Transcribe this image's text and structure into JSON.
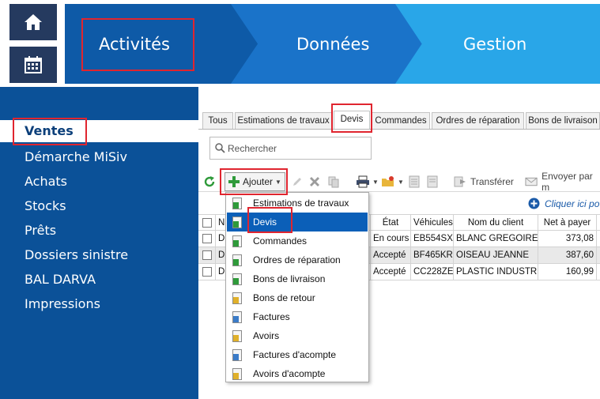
{
  "banner": {
    "steps": [
      {
        "label": "Activités"
      },
      {
        "label": "Données"
      },
      {
        "label": "Gestion"
      }
    ]
  },
  "sidebar": {
    "items": [
      {
        "label": "Ventes"
      },
      {
        "label": "Démarche MiSiv"
      },
      {
        "label": "Achats"
      },
      {
        "label": "Stocks"
      },
      {
        "label": "Prêts"
      },
      {
        "label": "Dossiers sinistre"
      },
      {
        "label": "BAL DARVA"
      },
      {
        "label": "Impressions"
      }
    ],
    "active": "Ventes"
  },
  "tabs": {
    "items": [
      {
        "label": "Tous"
      },
      {
        "label": "Estimations de travaux"
      },
      {
        "label": "Devis"
      },
      {
        "label": "Commandes"
      },
      {
        "label": "Ordres de réparation"
      },
      {
        "label": "Bons de livraison"
      }
    ],
    "active": "Devis"
  },
  "search": {
    "placeholder": "Rechercher"
  },
  "toolbar": {
    "add_label": "Ajouter",
    "transfer_label": "Transférer",
    "send_label": "Envoyer par m"
  },
  "link": {
    "label": "Cliquer ici po"
  },
  "table": {
    "columns": [
      "",
      "N",
      "État",
      "Véhicules",
      "Nom du client",
      "Net à payer"
    ],
    "rows": [
      {
        "id": "D",
        "etat": "En cours",
        "vehicule": "EB554SX",
        "client": "BLANC GREGOIRE",
        "net": "373,08"
      },
      {
        "id": "D",
        "etat": "Accepté",
        "vehicule": "BF465KR",
        "client": "OISEAU JEANNE",
        "net": "387,60"
      },
      {
        "id": "D",
        "etat": "Accepté",
        "vehicule": "CC228ZE",
        "client": "PLASTIC INDUSTRIE",
        "net": "160,99"
      }
    ]
  },
  "dropdown": {
    "items": [
      {
        "label": "Estimations de travaux",
        "icon": "doc-green-icon"
      },
      {
        "label": "Devis",
        "icon": "doc-green-icon"
      },
      {
        "label": "Commandes",
        "icon": "doc-green-icon"
      },
      {
        "label": "Ordres de réparation",
        "icon": "doc-green-icon"
      },
      {
        "label": "Bons de livraison",
        "icon": "doc-green-icon"
      },
      {
        "label": "Bons de retour",
        "icon": "doc-yellow-icon"
      },
      {
        "label": "Factures",
        "icon": "doc-blue-icon"
      },
      {
        "label": "Avoirs",
        "icon": "doc-yellow-icon"
      },
      {
        "label": "Factures d'acompte",
        "icon": "doc-blue-icon"
      },
      {
        "label": "Avoirs d'acompte",
        "icon": "doc-yellow-icon"
      }
    ],
    "selected": "Devis"
  },
  "colors": {
    "nav_bg": "#0b5198",
    "step_1": "#0e5aa7",
    "step_2": "#1a73c9",
    "step_3": "#29a6e8",
    "highlight": "#e0252f",
    "selection": "#0b5fb8"
  }
}
